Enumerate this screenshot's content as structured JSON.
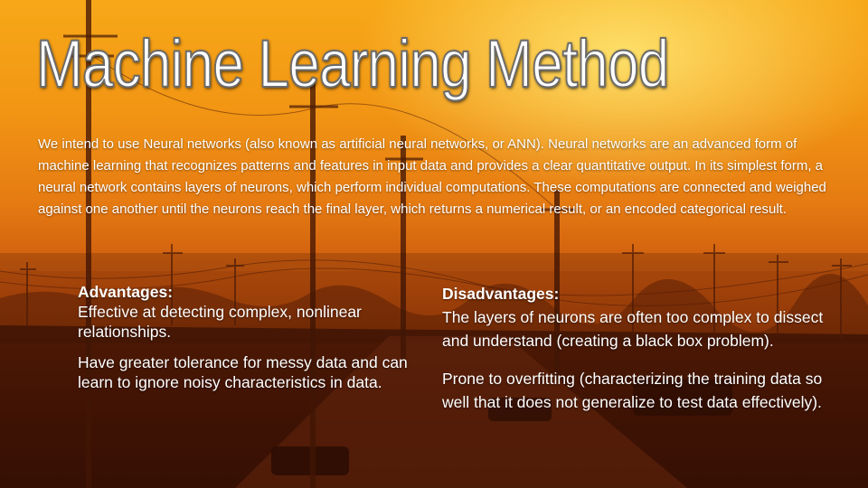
{
  "slide": {
    "title": "Machine Learning Method",
    "intro": "We intend to use Neural networks (also known as artificial neural networks, or ANN). Neural networks are an advanced form of machine learning that recognizes patterns and features in input data and provides a clear quantitative output. In its simplest form, a neural network contains layers of neurons, which perform individual computations. These computations are connected and weighed against one another until the neurons reach the final layer, which returns a numerical result, or an encoded categorical result.",
    "advantages": {
      "heading": "Advantages:",
      "items": [
        "Effective at detecting complex, nonlinear relationships.",
        "Have greater tolerance for messy data and can learn to ignore noisy characteristics in data."
      ]
    },
    "disadvantages": {
      "heading": "Disadvantages:",
      "items": [
        "The layers of neurons are often too complex to dissect and understand (creating a black box problem).",
        "Prone to overfitting (characterizing the training data so well that it does not generalize to test data effectively)."
      ]
    }
  },
  "colors": {
    "sky_top": "#f7a818",
    "sky_mid": "#e57a12",
    "ground_dark": "#3a1205",
    "text": "#ffffff",
    "title_outline": "#6b6b6b"
  }
}
